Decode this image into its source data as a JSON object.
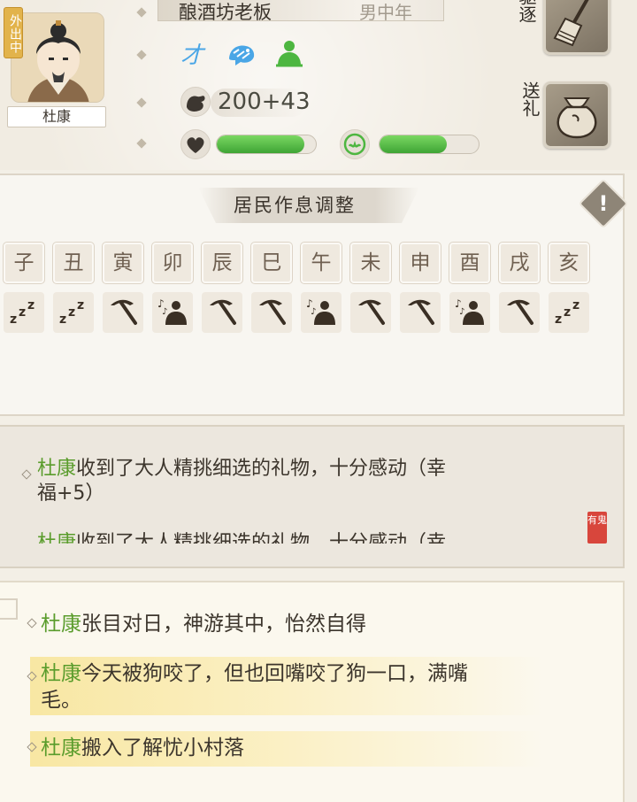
{
  "profile": {
    "status_badge": "外出中",
    "name": "杜康",
    "title": "酿酒坊老板",
    "subtitle": "男中年",
    "traits": [
      {
        "icon": "talent-icon",
        "glyph": "才"
      },
      {
        "icon": "tiger-icon"
      },
      {
        "icon": "meditation-icon"
      }
    ],
    "stat": {
      "icon": "strength-icon",
      "value": "200+43"
    },
    "bars": [
      {
        "icon": "heart-icon",
        "fill": 0.88
      },
      {
        "icon": "happiness-icon",
        "fill": 0.68
      }
    ],
    "actions": [
      {
        "label": "驱逐",
        "icon": "broom-icon",
        "visible_label": "驱逐"
      },
      {
        "label": "送礼",
        "icon": "gift-bag-icon"
      }
    ]
  },
  "schedule": {
    "title": "居民作息调整",
    "hours": [
      "子",
      "丑",
      "寅",
      "卯",
      "辰",
      "巳",
      "午",
      "未",
      "申",
      "酉",
      "戌",
      "亥"
    ],
    "activities": [
      "sleep",
      "sleep",
      "work",
      "rest",
      "work",
      "work",
      "rest",
      "work",
      "work",
      "rest",
      "work",
      "sleep"
    ]
  },
  "log1": {
    "name": "杜康",
    "text_a": "收到了大人精挑细选的礼物，十分感动（幸",
    "text_b": "福+5）",
    "text_c": "收到了大人精挑细选的礼物，十分感动（幸",
    "seal": "有鬼"
  },
  "log2": {
    "entries": [
      {
        "name": "杜康",
        "text": "张目对日，神游其中，怡然自得",
        "highlight": false
      },
      {
        "name": "杜康",
        "text": "今天被狗咬了，但也回嘴咬了狗一口，满嘴",
        "text2": "毛。",
        "highlight": true
      },
      {
        "name": "杜康",
        "text": "搬入了解忧小村落",
        "highlight": true
      }
    ]
  },
  "colors": {
    "name_green": "#5a9c2c",
    "bar_green": "#4fbf3f",
    "highlight": "#f8e7a3"
  }
}
